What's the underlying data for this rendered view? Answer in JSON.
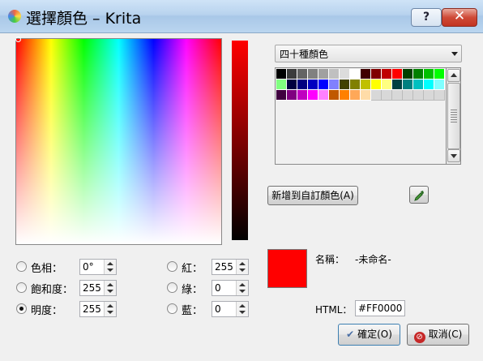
{
  "window": {
    "title": "選擇顏色 – Krita",
    "help_label": "?",
    "close_label": "✕"
  },
  "colors": {
    "selected": "#FF0000"
  },
  "left_fields": [
    {
      "label": "色相：",
      "value": "0°",
      "checked": false
    },
    {
      "label": "飽和度：",
      "value": "255",
      "checked": false
    },
    {
      "label": "明度：",
      "value": "255",
      "checked": true
    }
  ],
  "right_fields": [
    {
      "label": "紅：",
      "value": "255",
      "checked": false
    },
    {
      "label": "綠：",
      "value": "0",
      "checked": false
    },
    {
      "label": "藍：",
      "value": "0",
      "checked": false
    }
  ],
  "palette": {
    "selected": "四十種顏色",
    "swatches": [
      "#000000",
      "#3c3c3c",
      "#646464",
      "#808080",
      "#a0a0a0",
      "#c0c0c0",
      "#dcdcdc",
      "#ffffff",
      "#400000",
      "#800000",
      "#c00000",
      "#ff0000",
      "#004000",
      "#008000",
      "#00c000",
      "#00ff00",
      "#80ff80",
      "#000040",
      "#000080",
      "#0000c0",
      "#0000ff",
      "#8080ff",
      "#404000",
      "#808000",
      "#c0c000",
      "#ffff00",
      "#ffff80",
      "#004040",
      "#008080",
      "#00c0c0",
      "#00ffff",
      "#80ffff",
      "#400040",
      "#800080",
      "#c000c0",
      "#ff00ff",
      "#ff80ff",
      "#c05800",
      "#ff8000",
      "#ffa858",
      "#ffdca8"
    ],
    "empty_slots": 7
  },
  "add_custom_label": "新增到自訂顏色(A)",
  "name": {
    "label": "名稱：",
    "value": "-未命名-"
  },
  "html": {
    "label": "HTML：",
    "value": "#FF0000"
  },
  "ok_label": "確定(O)",
  "cancel_label": "取消(C)"
}
